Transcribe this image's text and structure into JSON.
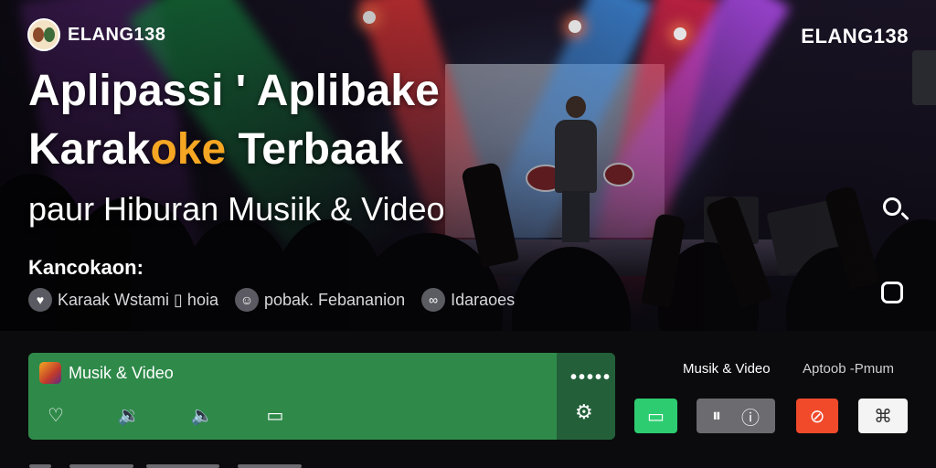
{
  "brand": {
    "left_name": "ELANG138",
    "right_name": "ELANG138"
  },
  "hero": {
    "title_line1": "Aplipassi ' Aplibake",
    "title_line2_before": "Karak",
    "title_line2_accent": "oke",
    "title_line2_after": " Terbaak",
    "subtitle": "paur Hiburan Musiik & Video",
    "section_label": "Kancokaon:",
    "chips": [
      {
        "icon": "heart-icon",
        "label": "Karaak Wstami ▯ hoia"
      },
      {
        "icon": "smile-icon",
        "label": "pobak. Febananion"
      },
      {
        "icon": "link-icon",
        "label": "Idaraoes"
      }
    ]
  },
  "player": {
    "title": "Musik & Video",
    "menu": "•••••"
  },
  "right_panel": {
    "label_a": "Musik & Video",
    "label_b": "Aptoob -Pmum"
  },
  "colors": {
    "accent": "#f5a623",
    "player_green": "#2f8a4a",
    "chat_green": "#2ecc71",
    "alert_red": "#f04a2b"
  }
}
